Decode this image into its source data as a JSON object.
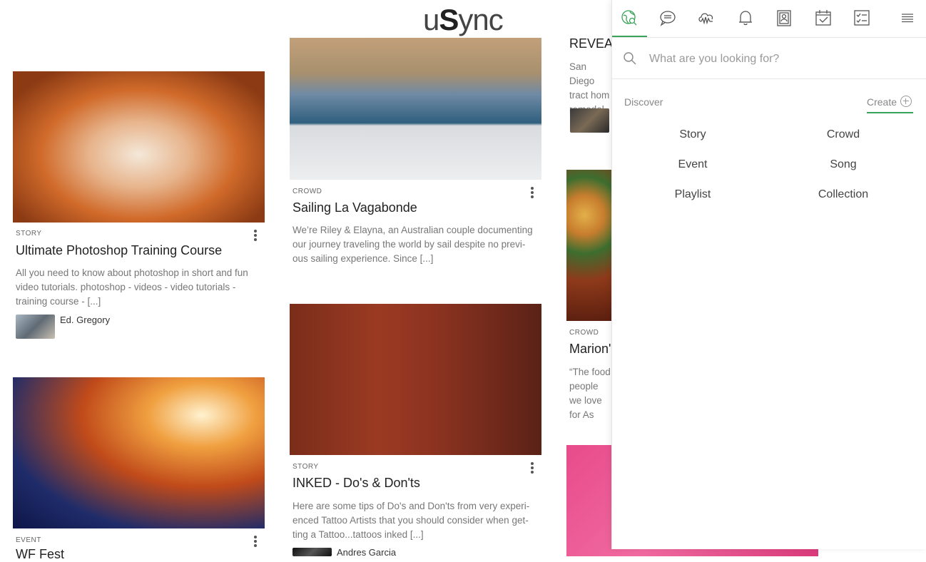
{
  "app": {
    "logo_prefix": "u",
    "logo_bold": "S",
    "logo_suffix": "ync"
  },
  "cards": {
    "c1": {
      "type": "STORY",
      "title": "Ultimate Photoshop Training Course",
      "desc": "All you need to know about photoshop in short and fun video tutorials. photoshop   -   videos   -   video tutorials   -   training course   -   [...]",
      "author": "Ed. Gregory"
    },
    "c2": {
      "type": "CROWD",
      "title": "Sailing La Vagabonde",
      "desc": "We’re Riley & Elayna, an Australian couple documenting our journey traveling the world by sail despite no previ-ous sailing experience. Since [...]"
    },
    "c3": {
      "type": "STORY",
      "title": "INKED - Do's & Don'ts",
      "desc": "Here are some tips of Do's and Don'ts from very experi-enced Tattoo Artists that you should consider when get-ting a Tattoo...tattoos    inked    [...]",
      "author": "Andres Garcia"
    },
    "c4": {
      "type": "EVENT",
      "title": "WF Fest"
    },
    "c5": {
      "title": "REVEAL",
      "desc": "San Diego tract hom remodel."
    },
    "c6": {
      "type": "CROWD",
      "title": "Marion'",
      "desc": "“The food people we love for As"
    }
  },
  "panel": {
    "nav_icons": [
      "discover-icon",
      "chat-icon",
      "cloud-music-icon",
      "bell-icon",
      "contacts-icon",
      "calendar-icon",
      "checklist-icon",
      "menu-icon"
    ],
    "search_placeholder": "What are you looking for?",
    "discover_label": "Discover",
    "create_label": "Create",
    "options": [
      "Story",
      "Crowd",
      "Event",
      "Song",
      "Playlist",
      "Collection"
    ]
  },
  "colors": {
    "accent": "#3aa35a"
  }
}
